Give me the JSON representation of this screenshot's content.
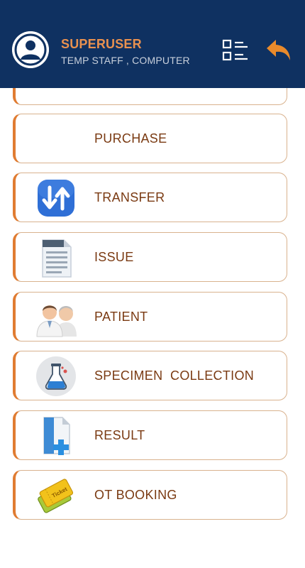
{
  "header": {
    "user_name": "SUPERUSER",
    "user_role": "TEMP STAFF , COMPUTER",
    "background_color": "#0f3161",
    "accent_color": "#e9914f"
  },
  "icons": {
    "avatar": "user-avatar-icon",
    "list_toggle": "list-view-icon",
    "back": "undo-arrow-icon"
  },
  "menu": {
    "items": [
      {
        "label": "PURCHASE",
        "icon": "none"
      },
      {
        "label": "TRANSFER",
        "icon": "transfer-arrows-icon"
      },
      {
        "label": "ISSUE",
        "icon": "document-icon"
      },
      {
        "label": "PATIENT",
        "icon": "patients-icon"
      },
      {
        "label": "SPECIMEN  COLLECTION",
        "icon": "lab-flask-icon"
      },
      {
        "label": "RESULT",
        "icon": "file-add-icon"
      },
      {
        "label": "OT BOOKING",
        "icon": "ticket-icon"
      }
    ]
  }
}
